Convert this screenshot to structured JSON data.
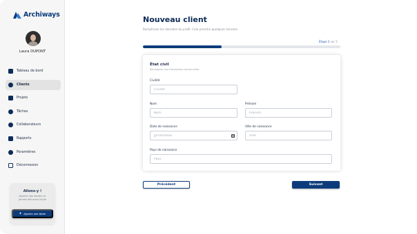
{
  "app": {
    "name": "Archiways"
  },
  "user": {
    "name": "Laura DUPONT"
  },
  "sidebar": {
    "items": [
      {
        "label": "Tableau de bord",
        "icon": "home-icon"
      },
      {
        "label": "Clients",
        "icon": "users-icon",
        "active": true
      },
      {
        "label": "Projets",
        "icon": "folder-icon"
      },
      {
        "label": "Tâches",
        "icon": "tasks-icon"
      },
      {
        "label": "Collaborateurs",
        "icon": "team-icon"
      },
      {
        "label": "Rapports",
        "icon": "chart-icon"
      },
      {
        "label": "Paramètres",
        "icon": "gear-icon"
      },
      {
        "label": "Déconnexion",
        "icon": "logout-icon"
      }
    ]
  },
  "promo": {
    "title": "Allons-y !",
    "text": "Ajouter des tâches ne jamais été aussi facile",
    "button_label": "Ajoutez une tâche"
  },
  "header": {
    "title": "Nouveau client",
    "subtitle": "Remplissez les données du profil. Cela prendra quelques minutes."
  },
  "progress": {
    "step_prefix": "Étape",
    "current": "2",
    "separator": "sur",
    "total": "5",
    "fraction": 0.4
  },
  "form": {
    "section_title": "État civil",
    "section_subtitle": "Renseignez vos informations personnelles",
    "fields": {
      "civilite": {
        "label": "Civilité",
        "placeholder": "Civilité"
      },
      "nom": {
        "label": "Nom",
        "placeholder": "Nom"
      },
      "prenom": {
        "label": "Prénom",
        "placeholder": "Prénom"
      },
      "date_naissance": {
        "label": "Date de naissance",
        "placeholder": "jj/mm/aaaa"
      },
      "ville_naissance": {
        "label": "Ville de naissance",
        "placeholder": "Ville"
      },
      "pays_naissance": {
        "label": "Pays de naissance",
        "placeholder": "Pays"
      }
    }
  },
  "actions": {
    "prev_label": "Précédent",
    "next_label": "Suivant"
  },
  "colors": {
    "primary": "#0b3b7a",
    "sidebar_bg": "#f6f6f6",
    "active_item_bg": "#e3e3e3"
  }
}
